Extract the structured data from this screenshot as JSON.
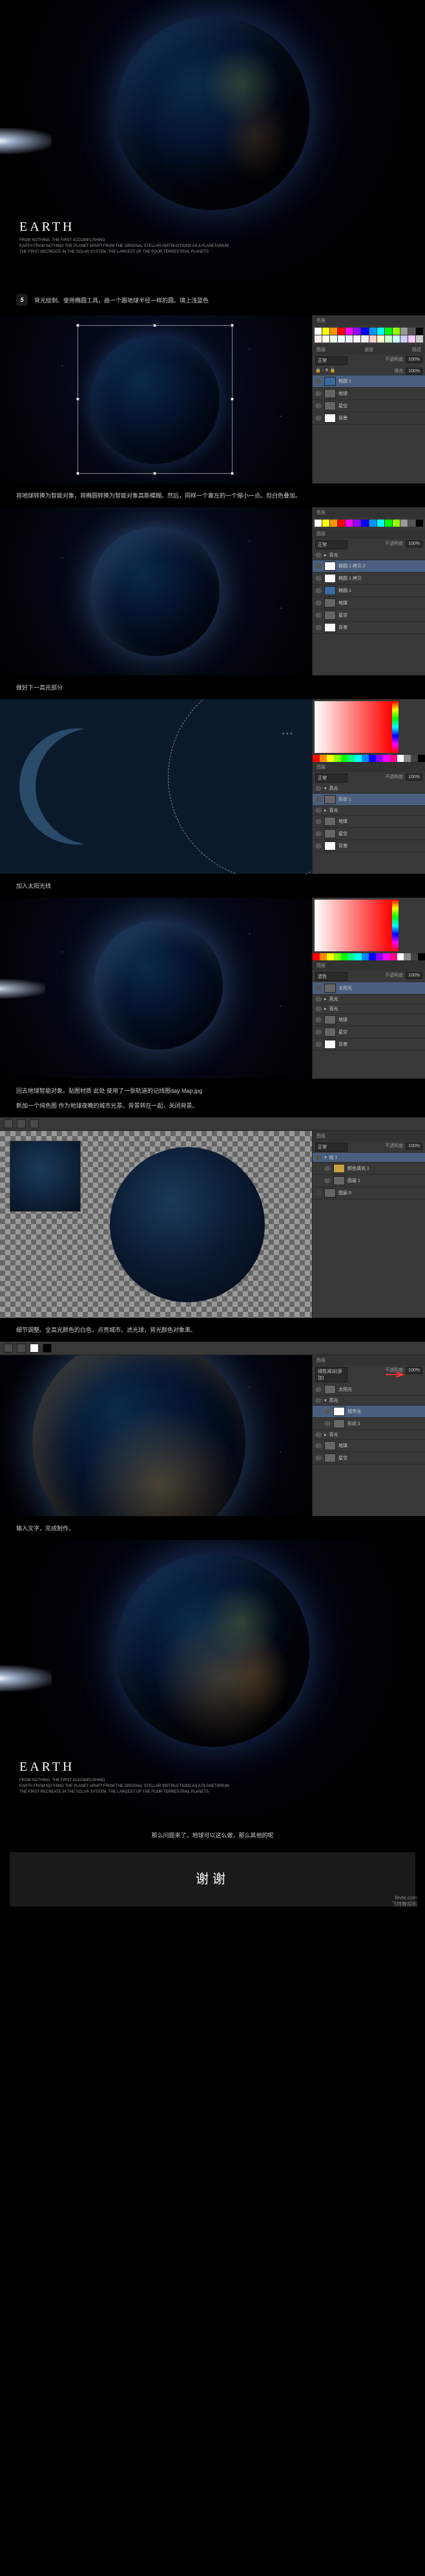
{
  "hero": {
    "title": "EARTH",
    "subtitle_small": "FROM NOTHING. THE FIRST ACCOMPLISHING",
    "subline1": "EARTH FROM NOTHING THE PLANET APART FROM THE ORIGINAL STELLAR INSTRUCTIONS AS A PLANETARIUM",
    "subline2": "THE FIRST RECREATE IN THE SOLAR SYSTEM. THE LARGEST OF THE FOUR TERRESTRIAL PLANETS"
  },
  "steps": {
    "num5": "5",
    "text5": "背光绘制。使用椭圆工具，画一个跟地球半径一样的圆。填上浅蓝色",
    "cap2": "将地球转换为智能对象，将椭圆转换为智能对象高斯模糊。然后，同样一个靠左的一个缩小一点。但白色叠加。",
    "cap3": "做好下一高光部分",
    "cap4": "加入太阳光线",
    "cap5": "回去地球智能对象。贴图材质 此处 使用了一张轨道的记线图day Map.jpg\n\n新加一个纯色图 作为地球夜晚的城市光景。背景转在一起，关闭背景。",
    "cap6": "细节调整。全高光颜色的白色，点亮城市。滤光球，背光颜色对象黑。",
    "cap7": "输入文字，完成制作。"
  },
  "ps": {
    "swatches_label": "色板",
    "layers_label": "图层",
    "channels_label": "通道",
    "paths_label": "路径",
    "normal": "正常",
    "opacity_label": "不透明度:",
    "fill_label": "填充:",
    "opacity_val": "100%",
    "layer_names": {
      "bg_light": "背光",
      "earth": "地球",
      "starfield": "星空",
      "background": "背景",
      "ellipse1": "椭圆 1",
      "ellipse1_copy": "椭圆 1 拷贝",
      "ellipse1_copy2": "椭圆 1 拷贝 2",
      "group1": "组 1",
      "color_fill": "颜色填充 1",
      "layer1": "图层 1",
      "layer0": "图层 0",
      "city_light": "城市光",
      "highlight": "高光",
      "sunlight": "太阳光",
      "shape1": "形状 1"
    },
    "picker_hex": "3a6a9f",
    "picker_r": "58",
    "picker_g": "106",
    "picker_b": "159",
    "blend_screen": "滤色",
    "blend_linear_dodge": "线性减淡(添加)"
  },
  "colors": {
    "swatch_row": [
      "#ffffff",
      "#ffff00",
      "#ff9500",
      "#ff0000",
      "#ff00ff",
      "#9500ff",
      "#0000ff",
      "#0095ff",
      "#00ffff",
      "#00ff00",
      "#95ff00",
      "#959595",
      "#4a4a4a",
      "#000000"
    ]
  },
  "footer": {
    "question": "那么问题来了，地球可以这么做，那么其他的呢",
    "thanks": "谢谢",
    "watermark": "fevte.com\n飞特教程网"
  }
}
